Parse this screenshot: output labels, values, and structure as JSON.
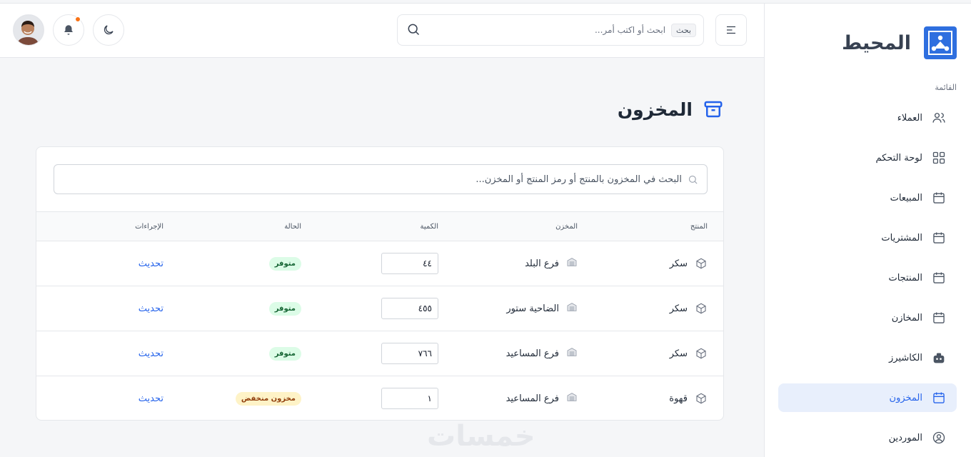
{
  "brand": {
    "name": "المحيط"
  },
  "sidebar": {
    "caption": "القائمة",
    "items": [
      {
        "label": "العملاء",
        "icon": "users-icon"
      },
      {
        "label": "لوحة التحكم",
        "icon": "grid-icon"
      },
      {
        "label": "المبيعات",
        "icon": "calendar-icon"
      },
      {
        "label": "المشتريات",
        "icon": "calendar-icon"
      },
      {
        "label": "المنتجات",
        "icon": "calendar-icon"
      },
      {
        "label": "المخازن",
        "icon": "calendar-icon"
      },
      {
        "label": "الكاشيرز",
        "icon": "robot-icon"
      },
      {
        "label": "المخزون",
        "icon": "calendar-icon",
        "active": true
      },
      {
        "label": "الموردين",
        "icon": "user-circle-icon"
      }
    ]
  },
  "topbar": {
    "search_badge": "بحث",
    "search_placeholder": "ابحث أو اكتب أمر..."
  },
  "page": {
    "title": "المخزون"
  },
  "inventory": {
    "search_placeholder": "البحث في المخزون بالمنتج أو رمز المنتج أو المخزن...",
    "columns": {
      "product": "المنتج",
      "store": "المخزن",
      "quantity": "الكمية",
      "status": "الحالة",
      "actions": "الإجراءات"
    },
    "rows": [
      {
        "product": "سكر",
        "store": "فرع البلد",
        "quantity": "٤٤",
        "status": "متوفر",
        "status_type": "ok",
        "action": "تحديث"
      },
      {
        "product": "سكر",
        "store": "الضاحية ستور",
        "quantity": "٤٥٥",
        "status": "متوفر",
        "status_type": "ok",
        "action": "تحديث"
      },
      {
        "product": "سكر",
        "store": "فرع المساعيد",
        "quantity": "٧٦٦",
        "status": "متوفر",
        "status_type": "ok",
        "action": "تحديث"
      },
      {
        "product": "قهوة",
        "store": "فرع المساعيد",
        "quantity": "١",
        "status": "مخزون منخفض",
        "status_type": "low",
        "action": "تحديث"
      }
    ]
  },
  "watermark": "خمسات",
  "colors": {
    "accent": "#2563eb",
    "brand_logo": "#2f6fdf",
    "badge_ok": "#dcfce7",
    "badge_low": "#fef3c7",
    "notification": "#f97316"
  }
}
